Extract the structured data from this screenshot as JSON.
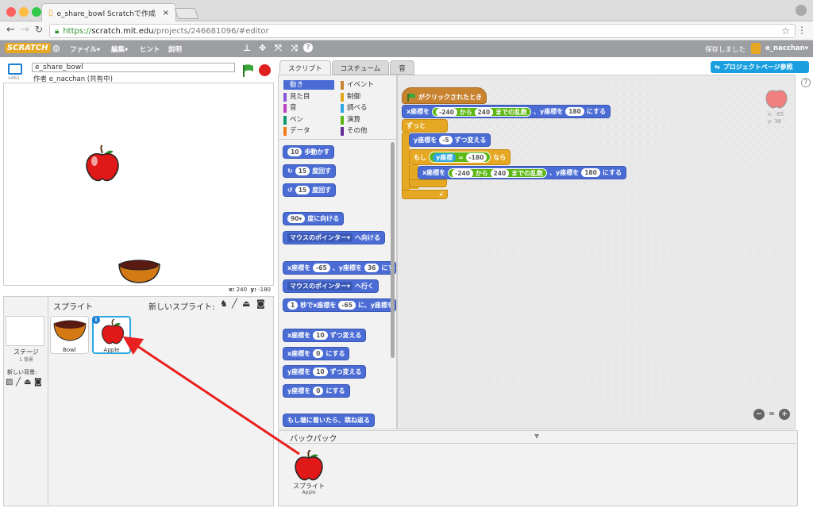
{
  "browser": {
    "tab_title": "e_share_bowl Scratchで作成",
    "url_prefix": "https://",
    "url_host": "scratch.mit.edu",
    "url_path": "/projects/246681096/#editor"
  },
  "menubar": {
    "logo": "SCRATCH",
    "items": [
      "ファイル▾",
      "編集▾",
      "ヒント",
      "説明"
    ],
    "saved_status": "保存しました",
    "username": "e_nacchan▾"
  },
  "stage_header": {
    "version": "v461",
    "project_title": "e_share_bowl",
    "author": "作者 e_nacchan (共有中)"
  },
  "coords": {
    "x_label": "x:",
    "x": "240",
    "y_label": "y:",
    "y": "-180"
  },
  "sprites": {
    "header": "スプライト",
    "new_sprite": "新しいスプライト:",
    "stage_label": "ステージ",
    "stage_sub": "1 背景",
    "new_backdrop": "新しい背景:",
    "items": [
      {
        "name": "Bowl"
      },
      {
        "name": "Apple"
      }
    ],
    "info_badge": "i"
  },
  "tabs": [
    "スクリプト",
    "コスチューム",
    "音"
  ],
  "categories": [
    {
      "label": "動き",
      "color": "#4a6cd4"
    },
    {
      "label": "イベント",
      "color": "#c88330"
    },
    {
      "label": "見た目",
      "color": "#8a55d7"
    },
    {
      "label": "制御",
      "color": "#e1a91a"
    },
    {
      "label": "音",
      "color": "#bb42c3"
    },
    {
      "label": "調べる",
      "color": "#2ca5e2"
    },
    {
      "label": "ペン",
      "color": "#0e9a6c"
    },
    {
      "label": "演算",
      "color": "#5cb712"
    },
    {
      "label": "データ",
      "color": "#ee7d16"
    },
    {
      "label": "その他",
      "color": "#632d99"
    }
  ],
  "palette": {
    "move_steps": {
      "v": "10",
      "t": "歩動かす"
    },
    "turn_right": {
      "v": "15",
      "t": "度回す"
    },
    "turn_left": {
      "v": "15",
      "t": "度回す"
    },
    "point_dir": {
      "v": "90▾",
      "t": "度に向ける"
    },
    "point_towards": {
      "v": "マウスのポインター▾",
      "t": "へ向ける"
    },
    "goto_xy": {
      "a": "x座標を",
      "x": "-65",
      "b": "、y座標を",
      "y": "36",
      "c": "にする"
    },
    "goto": {
      "v": "マウスのポインター▾",
      "t": "へ行く"
    },
    "glide": {
      "v": "1",
      "a": "秒でx座標を",
      "x": "-65",
      "b": "に、y座標を"
    },
    "change_x": {
      "a": "x座標を",
      "v": "10",
      "t": "ずつ変える"
    },
    "set_x": {
      "a": "x座標を",
      "v": "0",
      "t": "にする"
    },
    "change_y": {
      "a": "y座標を",
      "v": "10",
      "t": "ずつ変える"
    },
    "set_y": {
      "a": "y座標を",
      "v": "0",
      "t": "にする"
    },
    "bounce": "もし端に着いたら、跳ね返る"
  },
  "script": {
    "hat": "がクリックされたとき",
    "set1": {
      "a": "x座標を",
      "v1": "-240",
      "b": "から",
      "v2": "240",
      "c": "までの乱数",
      "d": "、y座標を",
      "v3": "180",
      "e": "にする"
    },
    "forever": "ずっと",
    "change_y": {
      "a": "y座標を",
      "v": "-5",
      "t": "ずつ変える"
    },
    "if": {
      "a": "もし",
      "var": "y座標",
      "op": "=",
      "v": "-180",
      "b": "なら"
    },
    "set2": {
      "a": "x座標を",
      "v1": "-240",
      "b": "から",
      "v2": "240",
      "c": "までの乱数",
      "d": "、y座標を",
      "v3": "180",
      "e": "にする"
    },
    "sprite_x": "x: -65",
    "sprite_y": "y: 36"
  },
  "project_page_button": "プロジェクトページ参照",
  "zoom": {
    "out": "−",
    "reset": "=",
    "in": "+"
  },
  "backpack": {
    "title": "バックパック",
    "item_label": "スプライト",
    "item_sub": "Apple"
  }
}
